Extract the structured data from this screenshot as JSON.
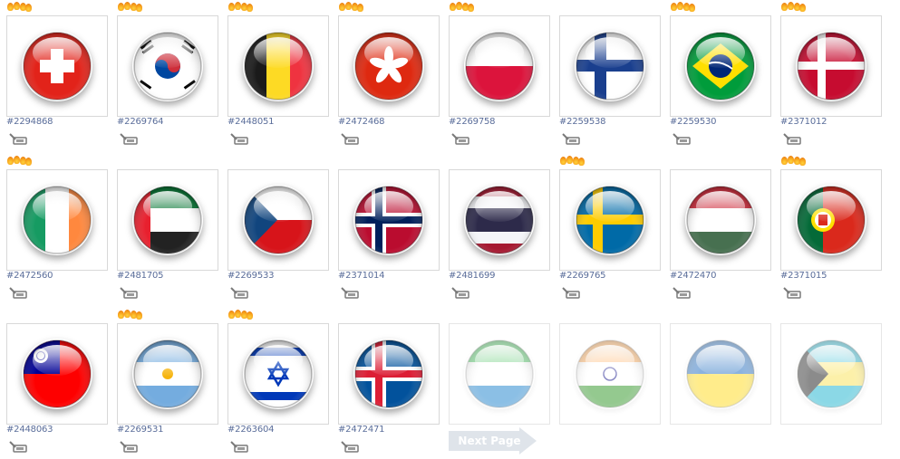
{
  "items": [
    {
      "id": "#2294868",
      "flag": "switzerland",
      "hot": true
    },
    {
      "id": "#2269764",
      "flag": "south-korea",
      "hot": true
    },
    {
      "id": "#2448051",
      "flag": "belgium",
      "hot": true
    },
    {
      "id": "#2472468",
      "flag": "hong-kong",
      "hot": true
    },
    {
      "id": "#2269758",
      "flag": "poland",
      "hot": true
    },
    {
      "id": "#2259538",
      "flag": "finland",
      "hot": false
    },
    {
      "id": "#2259530",
      "flag": "brazil",
      "hot": true
    },
    {
      "id": "#2371012",
      "flag": "denmark",
      "hot": true
    },
    {
      "id": "#2472560",
      "flag": "ireland",
      "hot": true
    },
    {
      "id": "#2481705",
      "flag": "uae",
      "hot": false
    },
    {
      "id": "#2269533",
      "flag": "czech-republic",
      "hot": false
    },
    {
      "id": "#2371014",
      "flag": "norway",
      "hot": false
    },
    {
      "id": "#2481699",
      "flag": "thailand",
      "hot": false
    },
    {
      "id": "#2269765",
      "flag": "sweden",
      "hot": true
    },
    {
      "id": "#2472470",
      "flag": "hungary",
      "hot": false
    },
    {
      "id": "#2371015",
      "flag": "portugal",
      "hot": true
    },
    {
      "id": "#2448063",
      "flag": "taiwan",
      "hot": false
    },
    {
      "id": "#2269531",
      "flag": "argentina",
      "hot": true
    },
    {
      "id": "#2263604",
      "flag": "israel",
      "hot": true
    },
    {
      "id": "#2472471",
      "flag": "iceland",
      "hot": false
    },
    {
      "id": "",
      "flag": "sierra-leone",
      "hot": false,
      "faded": true
    },
    {
      "id": "",
      "flag": "india",
      "hot": false,
      "faded": true
    },
    {
      "id": "",
      "flag": "ukraine",
      "hot": false,
      "faded": true
    },
    {
      "id": "",
      "flag": "bahamas",
      "hot": false,
      "faded": true
    }
  ],
  "next_page_label": "Next Page",
  "icons": {
    "hot": "flame-icon",
    "download": "download-icon"
  }
}
